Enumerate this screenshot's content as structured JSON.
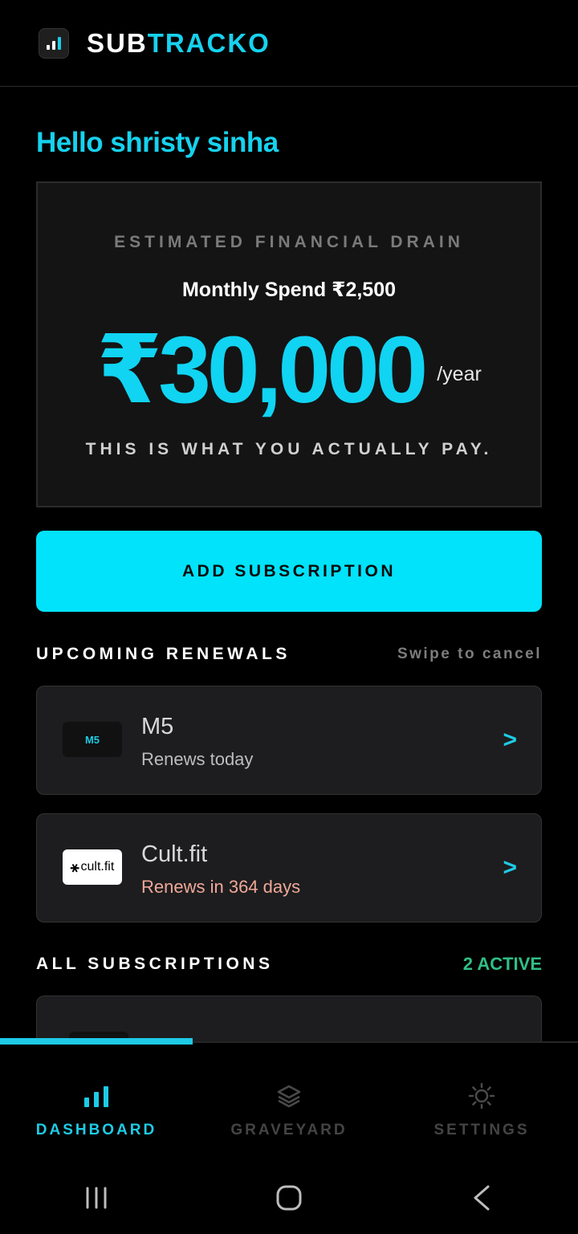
{
  "header": {
    "brand_part1": "SUB",
    "brand_part2": "TRACKO",
    "logo_icon": "bar-chart-icon"
  },
  "greeting": "Hello shristy sinha",
  "drain": {
    "label": "ESTIMATED FINANCIAL DRAIN",
    "monthly": "Monthly Spend ₹2,500",
    "yearly": "₹30,000",
    "per_year": "/year",
    "tagline": "THIS IS WHAT YOU ACTUALLY PAY."
  },
  "add_button": "ADD SUBSCRIPTION",
  "upcoming": {
    "title": "UPCOMING RENEWALS",
    "hint": "Swipe to cancel",
    "items": [
      {
        "thumb": "M5",
        "name": "M5",
        "status": "Renews today"
      },
      {
        "thumb": "cult.fit",
        "name": "Cult.fit",
        "status": "Renews in 364 days"
      }
    ],
    "chevron": ">"
  },
  "all_subs": {
    "title": "ALL SUBSCRIPTIONS",
    "count": "2 ACTIVE"
  },
  "nav": {
    "progress": 0.333,
    "items": [
      {
        "label": "DASHBOARD",
        "icon": "bar-chart-icon",
        "active": true
      },
      {
        "label": "GRAVEYARD",
        "icon": "layers-icon",
        "active": false
      },
      {
        "label": "SETTINGS",
        "icon": "sun-icon",
        "active": false
      }
    ]
  },
  "colors": {
    "accent": "#16d2ee",
    "button": "#00e3fb",
    "active_green": "#2fbf86",
    "renew_later": "#f0a898"
  }
}
